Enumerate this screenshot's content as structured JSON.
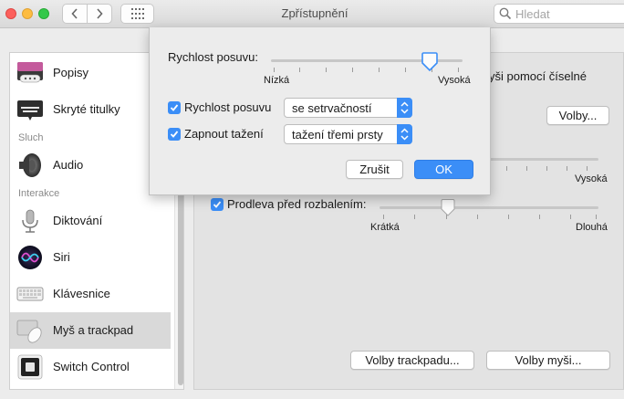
{
  "window": {
    "title": "Zpřístupnění"
  },
  "search": {
    "placeholder": "Hledat"
  },
  "sidebar": {
    "items": [
      {
        "label": "Popisy",
        "icon": "captions-icon"
      },
      {
        "label": "Skryté titulky",
        "icon": "closed-captions-icon"
      },
      {
        "label": "Audio",
        "icon": "speaker-icon"
      },
      {
        "label": "Diktování",
        "icon": "microphone-icon"
      },
      {
        "label": "Siri",
        "icon": "siri-icon"
      },
      {
        "label": "Klávesnice",
        "icon": "keyboard-icon"
      },
      {
        "label": "Myš a trackpad",
        "icon": "mouse-trackpad-icon",
        "selected": true
      },
      {
        "label": "Switch Control",
        "icon": "switch-control-icon"
      }
    ],
    "sections": {
      "hearing": "Sluch",
      "interaction": "Interakce"
    }
  },
  "main": {
    "partial_text": "yši pomocí číselné",
    "options_button": "Volby...",
    "speed_high_label": "Vysoká",
    "spring_delay": {
      "label": "Prodleva před rozbalením:",
      "checked": true,
      "min_label": "Krátká",
      "max_label": "Dlouhá",
      "value_fraction": 0.3
    },
    "trackpad_options_button": "Volby trackpadu...",
    "mouse_options_button": "Volby myši..."
  },
  "sheet": {
    "scroll_speed_label": "Rychlost posuvu:",
    "scroll_speed_min": "Nízká",
    "scroll_speed_max": "Vysoká",
    "scroll_speed_fraction": 0.8,
    "scrolling": {
      "label": "Rychlost posuvu",
      "checked": true,
      "value": "se setrvačností"
    },
    "dragging": {
      "label": "Zapnout tažení",
      "checked": true,
      "value": "tažení třemi prsty"
    },
    "cancel_button": "Zrušit",
    "ok_button": "OK"
  },
  "colors": {
    "accent": "#3b8ef7",
    "selected_row": "#d9d9d9"
  }
}
